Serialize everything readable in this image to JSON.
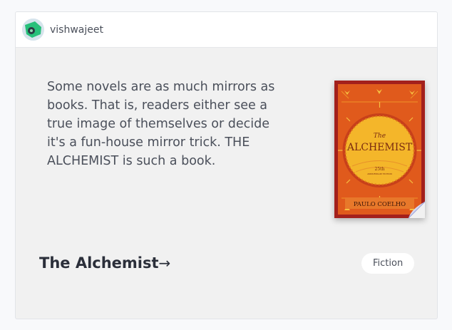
{
  "post": {
    "author": {
      "username": "vishwajeet"
    },
    "excerpt": "Some novels are as much mirrors as books. That is, readers either see a true image of themselves or decide it's a fun-house mirror trick. THE ALCHEMIST is such a book.",
    "book": {
      "title": "The Alchemist",
      "arrow": "→",
      "genre": "Fiction",
      "cover": {
        "title_line1": "The",
        "title_line2": "ALCHEMIST",
        "edition_number": "25th",
        "edition_text": "ANNIVERSARY EDITION",
        "author": "PAULO COELHO",
        "colors": {
          "border": "#a3201c",
          "field": "#e05a1c",
          "sun": "#f4b62a",
          "text": "#7a2a10"
        }
      }
    }
  }
}
